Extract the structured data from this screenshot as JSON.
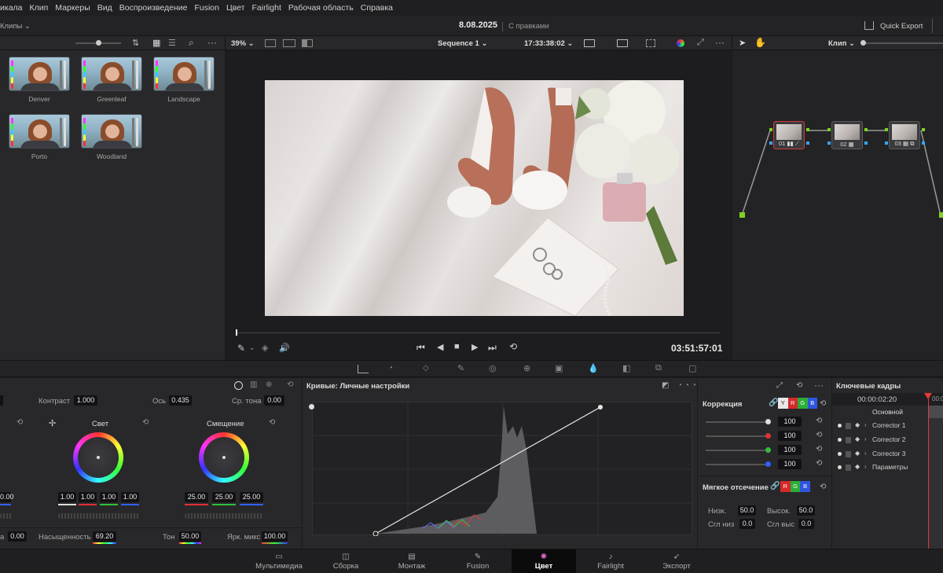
{
  "menubar": {
    "items": [
      "икала",
      "Клип",
      "Маркеры",
      "Вид",
      "Воспроизведение",
      "Fusion",
      "Цвет",
      "Fairlight",
      "Рабочая область",
      "Справка"
    ]
  },
  "topbar": {
    "left_label": "Клипы",
    "project_title": "8.08.2025",
    "project_status": "С правками",
    "quick_export": "Quick Export"
  },
  "viewer_toolbar": {
    "zoom": "39%",
    "sequence": "Sequence 1",
    "timecode": "17:33:38:02",
    "mode_label": "Клип"
  },
  "gallery": {
    "stills": [
      {
        "label": "Denver"
      },
      {
        "label": "Greenleaf"
      },
      {
        "label": "Landscape"
      },
      {
        "label": "Porto"
      },
      {
        "label": "Woodland"
      }
    ]
  },
  "playback": {
    "current_timecode": "03:51:57:01"
  },
  "nodes": [
    {
      "label": "01"
    },
    {
      "label": "02"
    },
    {
      "label": "03"
    }
  ],
  "primaries": {
    "contrast_label": "Контраст",
    "contrast_value": "1.000",
    "pivot_label": "Ось",
    "pivot_value": "0.435",
    "midtone_label": "Ср. тона",
    "midtone_value": "0.00",
    "left_partial_value": "0.00",
    "wheels": [
      {
        "title": "Свет",
        "values": [
          "1.00",
          "1.00",
          "1.00",
          "1.00"
        ]
      },
      {
        "title": "Смещение",
        "values": [
          "25.00",
          "25.00",
          "25.00"
        ]
      }
    ],
    "bottom_row": {
      "partial_label": "а",
      "partial_value": "0.00",
      "saturation_label": "Насыщенность",
      "saturation_value": "69.20",
      "hue_label": "Тон",
      "hue_value": "50.00",
      "lum_mix_label": "Ярк. микс",
      "lum_mix_value": "100.00"
    }
  },
  "curves": {
    "title": "Кривые: Личные настройки"
  },
  "correction": {
    "title": "Коррекция",
    "channels": [
      "Y",
      "R",
      "G",
      "B"
    ],
    "rows": [
      {
        "value": "100",
        "color": "#dddddd"
      },
      {
        "value": "100",
        "color": "#e23030"
      },
      {
        "value": "100",
        "color": "#2fbf3a"
      },
      {
        "value": "100",
        "color": "#3060ff"
      }
    ],
    "soft_clip_title": "Мягкое отсечение",
    "soft_channels": [
      "R",
      "G",
      "B"
    ],
    "low_label": "Низк.",
    "low_value": "50.0",
    "high_label": "Высок.",
    "high_value": "50.0",
    "low_soft_label": "Сгл низ",
    "low_soft_value": "0.0",
    "high_soft_label": "Сгл выс",
    "high_soft_value": "0.0"
  },
  "keyframes": {
    "title": "Ключевые кадры",
    "timecode": "00:00:02:20",
    "side_tc": "00:0",
    "main_label": "Основной",
    "rows": [
      "Corrector 1",
      "Corrector 2",
      "Corrector 3",
      "Параметры"
    ]
  },
  "bottom_nav": {
    "items": [
      {
        "label": "Мультимедиа",
        "icon": "media-icon"
      },
      {
        "label": "Сборка",
        "icon": "cut-icon"
      },
      {
        "label": "Монтаж",
        "icon": "edit-icon"
      },
      {
        "label": "Fusion",
        "icon": "fusion-icon"
      },
      {
        "label": "Цвет",
        "icon": "color-icon"
      },
      {
        "label": "Fairlight",
        "icon": "fairlight-icon"
      },
      {
        "label": "Экспорт",
        "icon": "deliver-icon"
      }
    ],
    "active": "Цвет"
  }
}
